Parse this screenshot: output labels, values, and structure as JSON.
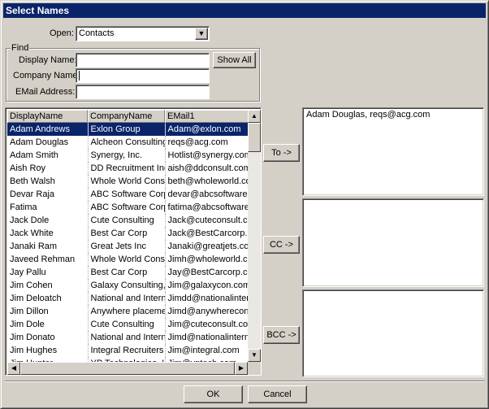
{
  "window": {
    "title": "Select Names"
  },
  "open": {
    "label": "Open:",
    "value": "Contacts"
  },
  "find": {
    "group_label": "Find",
    "display_name_label": "Display Name:",
    "display_name_value": "",
    "company_name_label": "Company Name",
    "company_name_value": "",
    "email_label": "EMail Address:",
    "email_value": "",
    "show_all_label": "Show All"
  },
  "list": {
    "columns": [
      "DisplayName",
      "CompanyName",
      "EMail1"
    ],
    "rows": [
      [
        "Adam Andrews",
        "Exlon Group",
        "Adam@exlon.com"
      ],
      [
        "Adam Douglas",
        "Alcheon Consulting",
        "reqs@acg.com"
      ],
      [
        "Adam Smith",
        "Synergy, Inc.",
        "Hotlist@synergy.com"
      ],
      [
        "Aish Roy",
        "DD Recruitment Inc",
        "aish@ddconsult.com"
      ],
      [
        "Beth Walsh",
        "Whole World Consulting",
        "beth@wholeworld.com"
      ],
      [
        "Devar Raja",
        "ABC Software Corp",
        "devar@abcsoftware.com"
      ],
      [
        "Fatima",
        "ABC Software Corp",
        "fatima@abcsoftware.com"
      ],
      [
        "Jack Dole",
        "Cute Consulting",
        "Jack@cuteconsult.com"
      ],
      [
        "Jack White",
        "Best Car Corp",
        "Jack@BestCarcorp.com"
      ],
      [
        "Janaki Ram",
        "Great Jets Inc",
        "Janaki@greatjets.com"
      ],
      [
        "Javeed Rehman",
        "Whole World Consulting",
        "Jimh@wholeworld.com"
      ],
      [
        "Jay Pallu",
        "Best Car Corp",
        "Jay@BestCarcorp.com"
      ],
      [
        "Jim Cohen",
        "Galaxy Consulting, Inc",
        "Jim@galaxycon.com"
      ],
      [
        "Jim Deloatch",
        "National and International",
        "Jimdd@nationalinternational.com"
      ],
      [
        "Jim Dillon",
        "Anywhere placement",
        "Jimd@anywhereconsult.com"
      ],
      [
        "Jim Dole",
        "Cute Consulting",
        "Jim@cuteconsult.com"
      ],
      [
        "Jim Donato",
        "National and International",
        "Jimd@nationalinternational.com"
      ],
      [
        "Jim Hughes",
        "Integral Recruiters",
        "Jim@integral.com"
      ],
      [
        "Jim Hunter",
        "YP Technologies, Inc",
        "Jim@yptech.com"
      ]
    ],
    "selected_index": 0
  },
  "buttons": {
    "to": "To ->",
    "cc": "CC ->",
    "bcc": "BCC ->",
    "ok": "OK",
    "cancel": "Cancel"
  },
  "recipients": {
    "to": "Adam Douglas, reqs@acg.com",
    "cc": "",
    "bcc": ""
  },
  "colors": {
    "titlebar": "#0a246a",
    "selection": "#0a246a",
    "face": "#d4d0c8"
  }
}
